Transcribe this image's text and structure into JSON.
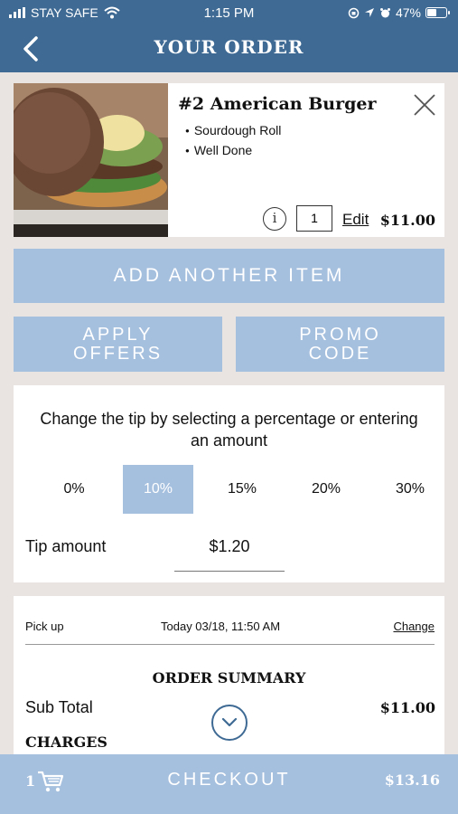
{
  "status_bar": {
    "carrier": "STAY SAFE",
    "time": "1:15 PM",
    "battery": "47%"
  },
  "nav": {
    "title": "YOUR ORDER",
    "back_icon": "chevron-left-icon"
  },
  "item": {
    "name": "#2 American Burger",
    "modifiers": [
      "Sourdough Roll",
      "Well Done"
    ],
    "quantity": "1",
    "edit_label": "Edit",
    "price": "$11.00",
    "info_label": "i"
  },
  "buttons": {
    "add_item": "ADD ANOTHER ITEM",
    "apply_offers_line1": "APPLY",
    "apply_offers_line2": "OFFERS",
    "promo_line1": "PROMO",
    "promo_line2": "CODE"
  },
  "tip": {
    "heading": "Change the tip by selecting a percentage or entering an amount",
    "options": [
      "0%",
      "10%",
      "15%",
      "20%",
      "30%"
    ],
    "selected": "10%",
    "amount_label": "Tip amount",
    "amount_value": "$1.20"
  },
  "summary": {
    "pickup_label": "Pick up",
    "pickup_time": "Today 03/18, 11:50 AM",
    "change_label": "Change",
    "title": "ORDER SUMMARY",
    "subtotal_label": "Sub Total",
    "subtotal_value": "$11.00",
    "charges_label": "CHARGES"
  },
  "checkout": {
    "cart_count": "1",
    "label": "CHECKOUT",
    "total": "$13.16"
  },
  "colors": {
    "brand": "#3e6a94",
    "accent": "#a5bfde",
    "background": "#e9e4e2"
  }
}
